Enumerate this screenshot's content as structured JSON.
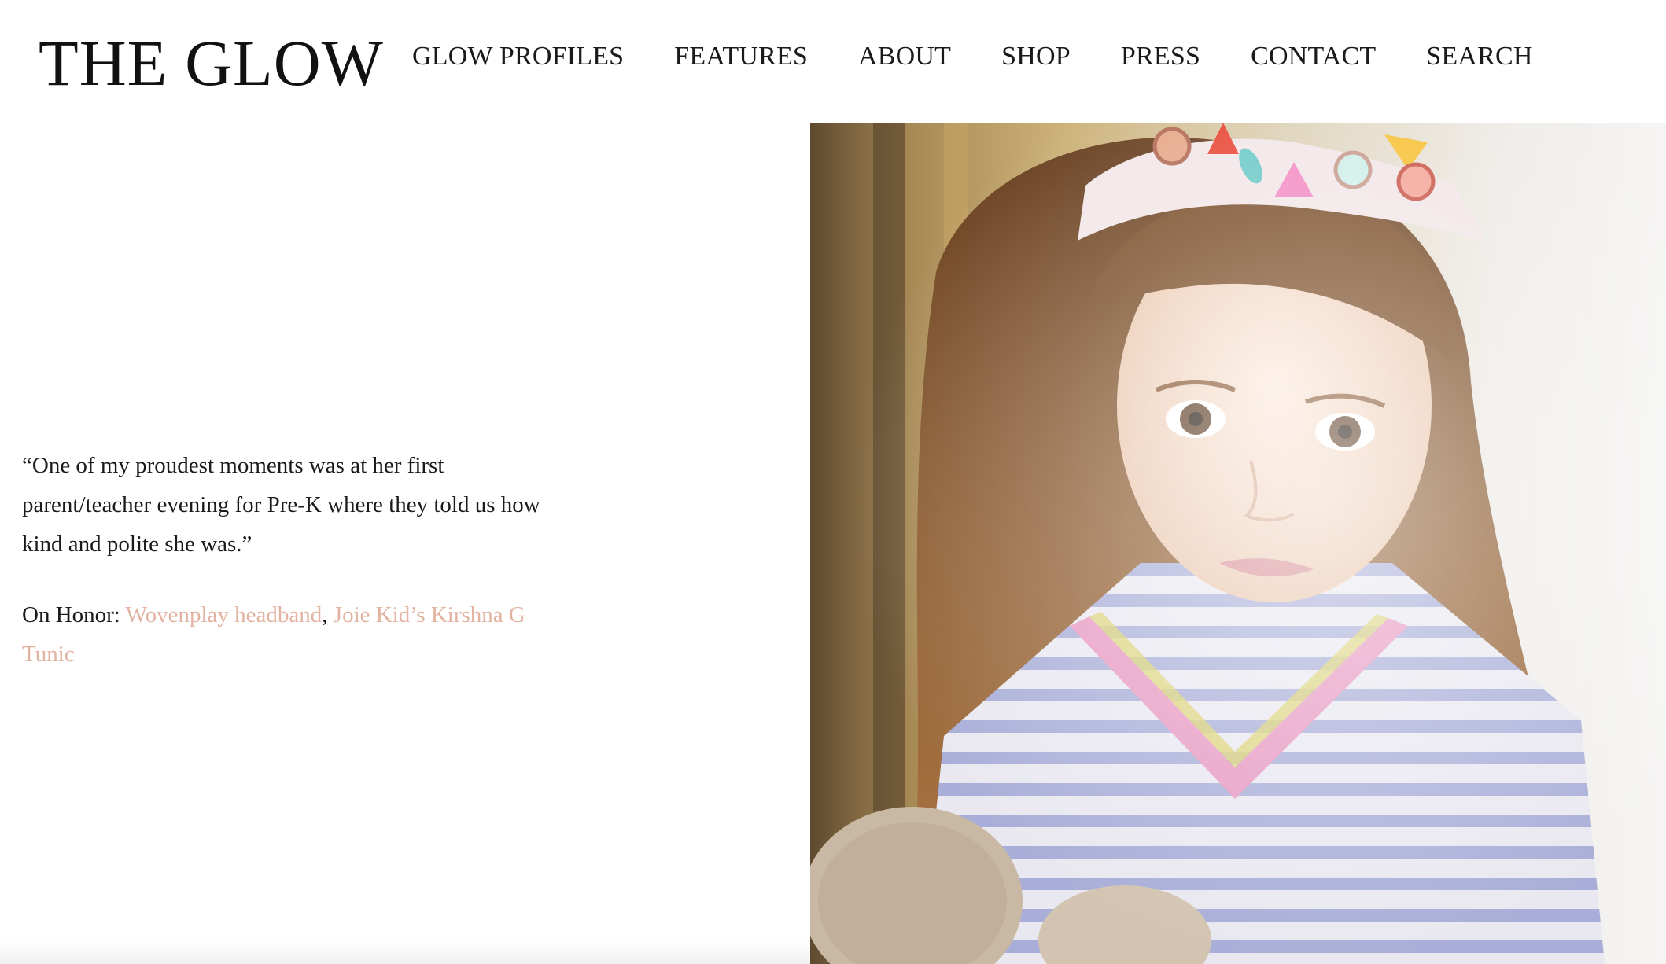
{
  "header": {
    "logo": "THE GLOW",
    "nav": [
      "GLOW PROFILES",
      "FEATURES",
      "ABOUT",
      "SHOP",
      "PRESS",
      "CONTACT",
      "SEARCH"
    ]
  },
  "article": {
    "quote": "“One of my proudest moments was at her first parent/teacher evening for Pre-K where they told us how kind and polite she was.”",
    "credits_label": "On Honor: ",
    "credit_links": [
      "Wovenplay headband",
      "Joie Kid’s Kirshna G Tunic"
    ],
    "credit_separator": ", "
  },
  "photo": {
    "description_icon": "portrait-photo",
    "colors": {
      "hair": "#8a5a2e",
      "skin": "#f2d8c4",
      "tunic_stripes": "#9ea6d6",
      "collar": "#e79ac2",
      "plush": "#c9b8a4"
    }
  },
  "colors": {
    "link": "#e3b3a2",
    "text": "#1a1a1a",
    "background": "#ffffff"
  }
}
